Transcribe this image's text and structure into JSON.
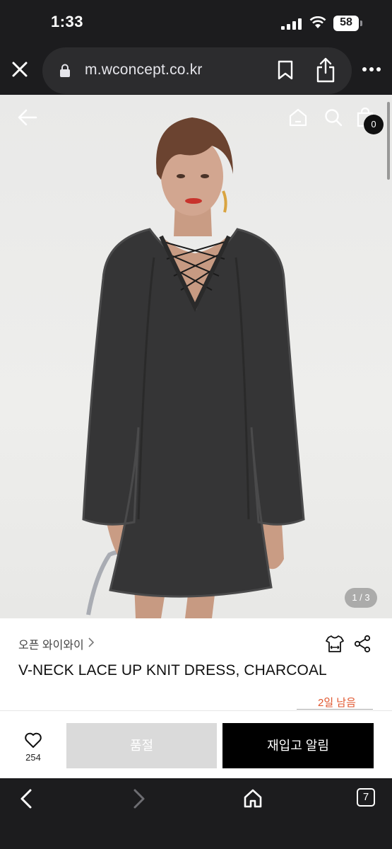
{
  "status_bar": {
    "time": "1:33",
    "battery_level": "58"
  },
  "browser": {
    "url": "m.wconcept.co.kr",
    "tab_count": "7"
  },
  "product_header": {
    "cart_count": "0",
    "image_indicator": "1 / 3"
  },
  "product": {
    "brand": "오픈 와이와이",
    "title": "V-NECK LACE UP KNIT DRESS, CHARCOAL",
    "stock_notice": "2일 남음"
  },
  "actions": {
    "wish_count": "254",
    "soldout_label": "품절",
    "restock_label": "재입고 알림"
  },
  "colors": {
    "stock_notice": "#e0562e",
    "restock_button": "#000000",
    "soldout_button": "#dadada"
  }
}
